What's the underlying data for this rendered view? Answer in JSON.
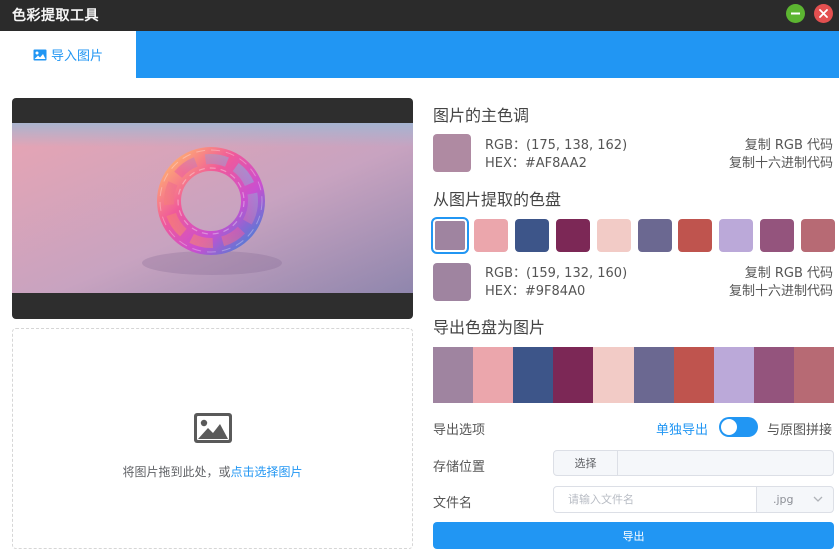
{
  "window": {
    "title": "色彩提取工具"
  },
  "tabs": [
    {
      "label": "导入图片",
      "icon": "image-icon",
      "active": true
    }
  ],
  "dropzone": {
    "text": "将图片拖到此处，或",
    "link": "点击选择图片",
    "icon": "image-icon"
  },
  "main_color": {
    "heading": "图片的主色调",
    "color": "#AF8AA2",
    "rgb_text": "RGB：(175, 138, 162)",
    "hex_text": "HEX：#AF8AA2",
    "copy_rgb": "复制 RGB 代码",
    "copy_hex": "复制十六进制代码"
  },
  "palette": {
    "heading": "从图片提取的色盘",
    "colors": [
      "#9F84A0",
      "#EBA6AC",
      "#3D5589",
      "#7C2856",
      "#F2CBC6",
      "#6B6891",
      "#BF544E",
      "#BBA9D9",
      "#94547D",
      "#B76A74"
    ],
    "selected_index": 0,
    "selected": {
      "color": "#9F84A0",
      "rgb_text": "RGB：(159, 132, 160)",
      "hex_text": "HEX：#9F84A0",
      "copy_rgb": "复制 RGB 代码",
      "copy_hex": "复制十六进制代码"
    }
  },
  "export": {
    "heading": "导出色盘为图片",
    "options_label": "导出选项",
    "option_separate": "单独导出",
    "option_merge": "与原图拼接",
    "toggle_on": true,
    "location_label": "存储位置",
    "choose_button": "选择",
    "filename_label": "文件名",
    "filename_placeholder": "请输入文件名",
    "extension": ".jpg",
    "export_button": "导出"
  },
  "colors": {
    "accent": "#2196F3",
    "titlebar": "#2B2B2B",
    "min_button": "#5CB531",
    "close_button": "#E35050"
  }
}
